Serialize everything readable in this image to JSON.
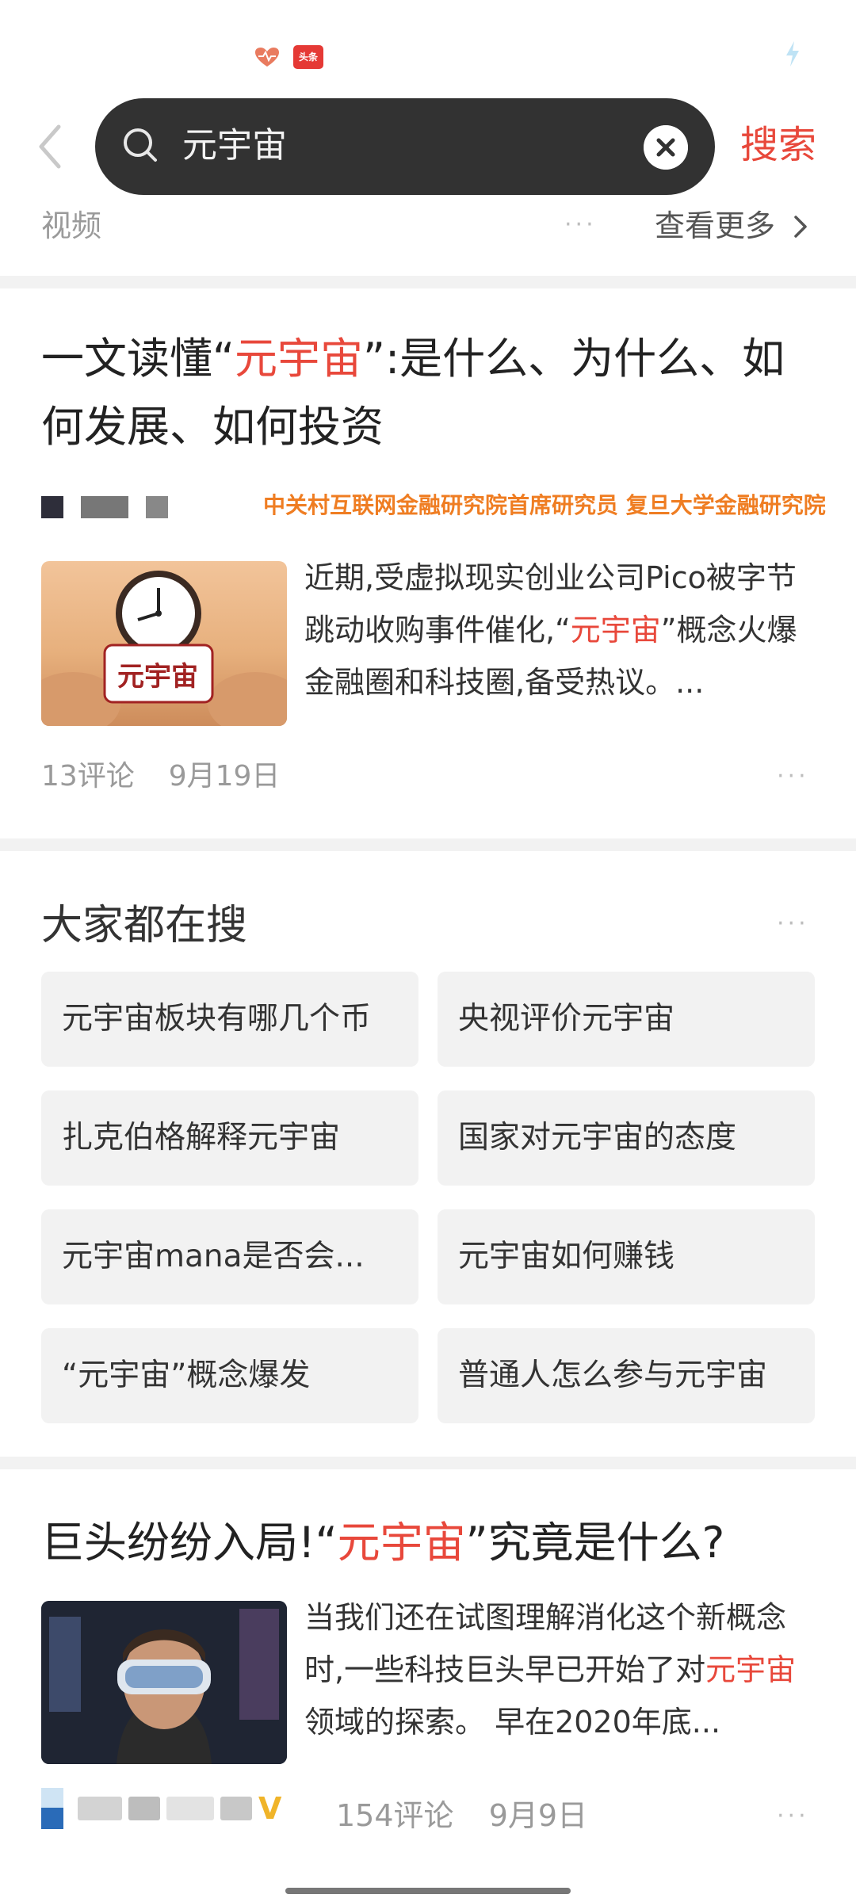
{
  "status_bar": {
    "badge_text": "头条"
  },
  "search": {
    "query": "元宇宙",
    "button_label": "搜索"
  },
  "video_row": {
    "label": "视频",
    "dots": "···",
    "see_more": "查看更多"
  },
  "article1": {
    "title_prefix": "一文读懂“",
    "title_highlight": "元宇宙",
    "title_suffix": "”:是什么、为什么、如何发展、如何投资",
    "author_tag": "中关村互联网金融研究院首席研究员 复旦大学金融研究院",
    "thumb_label": "元宇宙",
    "snippet_prefix": "近期,受虚拟现实创业公司Pico被字节跳动收购事件催化,“",
    "snippet_highlight": "元宇宙",
    "snippet_suffix": "”概念火爆金融圈和科技圈,备受热议。...",
    "comments": "13评论",
    "date": "9月19日",
    "dots": "···"
  },
  "trending": {
    "title": "大家都在搜",
    "dots": "···",
    "items": [
      "元宇宙板块有哪几个币",
      "央视评价元宇宙",
      "扎克伯格解释元宇宙",
      "国家对元宇宙的态度",
      "元宇宙mana是否会...",
      "元宇宙如何赚钱",
      "“元宇宙”概念爆发",
      "普通人怎么参与元宇宙"
    ]
  },
  "article2": {
    "title_prefix": "巨头纷纷入局!“",
    "title_highlight": "元宇宙",
    "title_suffix": "”究竟是什么?",
    "snippet_prefix": "当我们还在试图理解消化这个新概念时,一些科技巨头早已开始了对",
    "snippet_highlight": "元宇宙",
    "snippet_suffix": "领域的探索。 早在2020年底...",
    "verified_badge": "V",
    "comments": "154评论",
    "date": "9月9日",
    "dots": "···"
  },
  "colors": {
    "accent_red": "#e8483b",
    "search_bg": "#323232",
    "author_orange": "#ef7d22",
    "separator": "#f2f2f2"
  }
}
